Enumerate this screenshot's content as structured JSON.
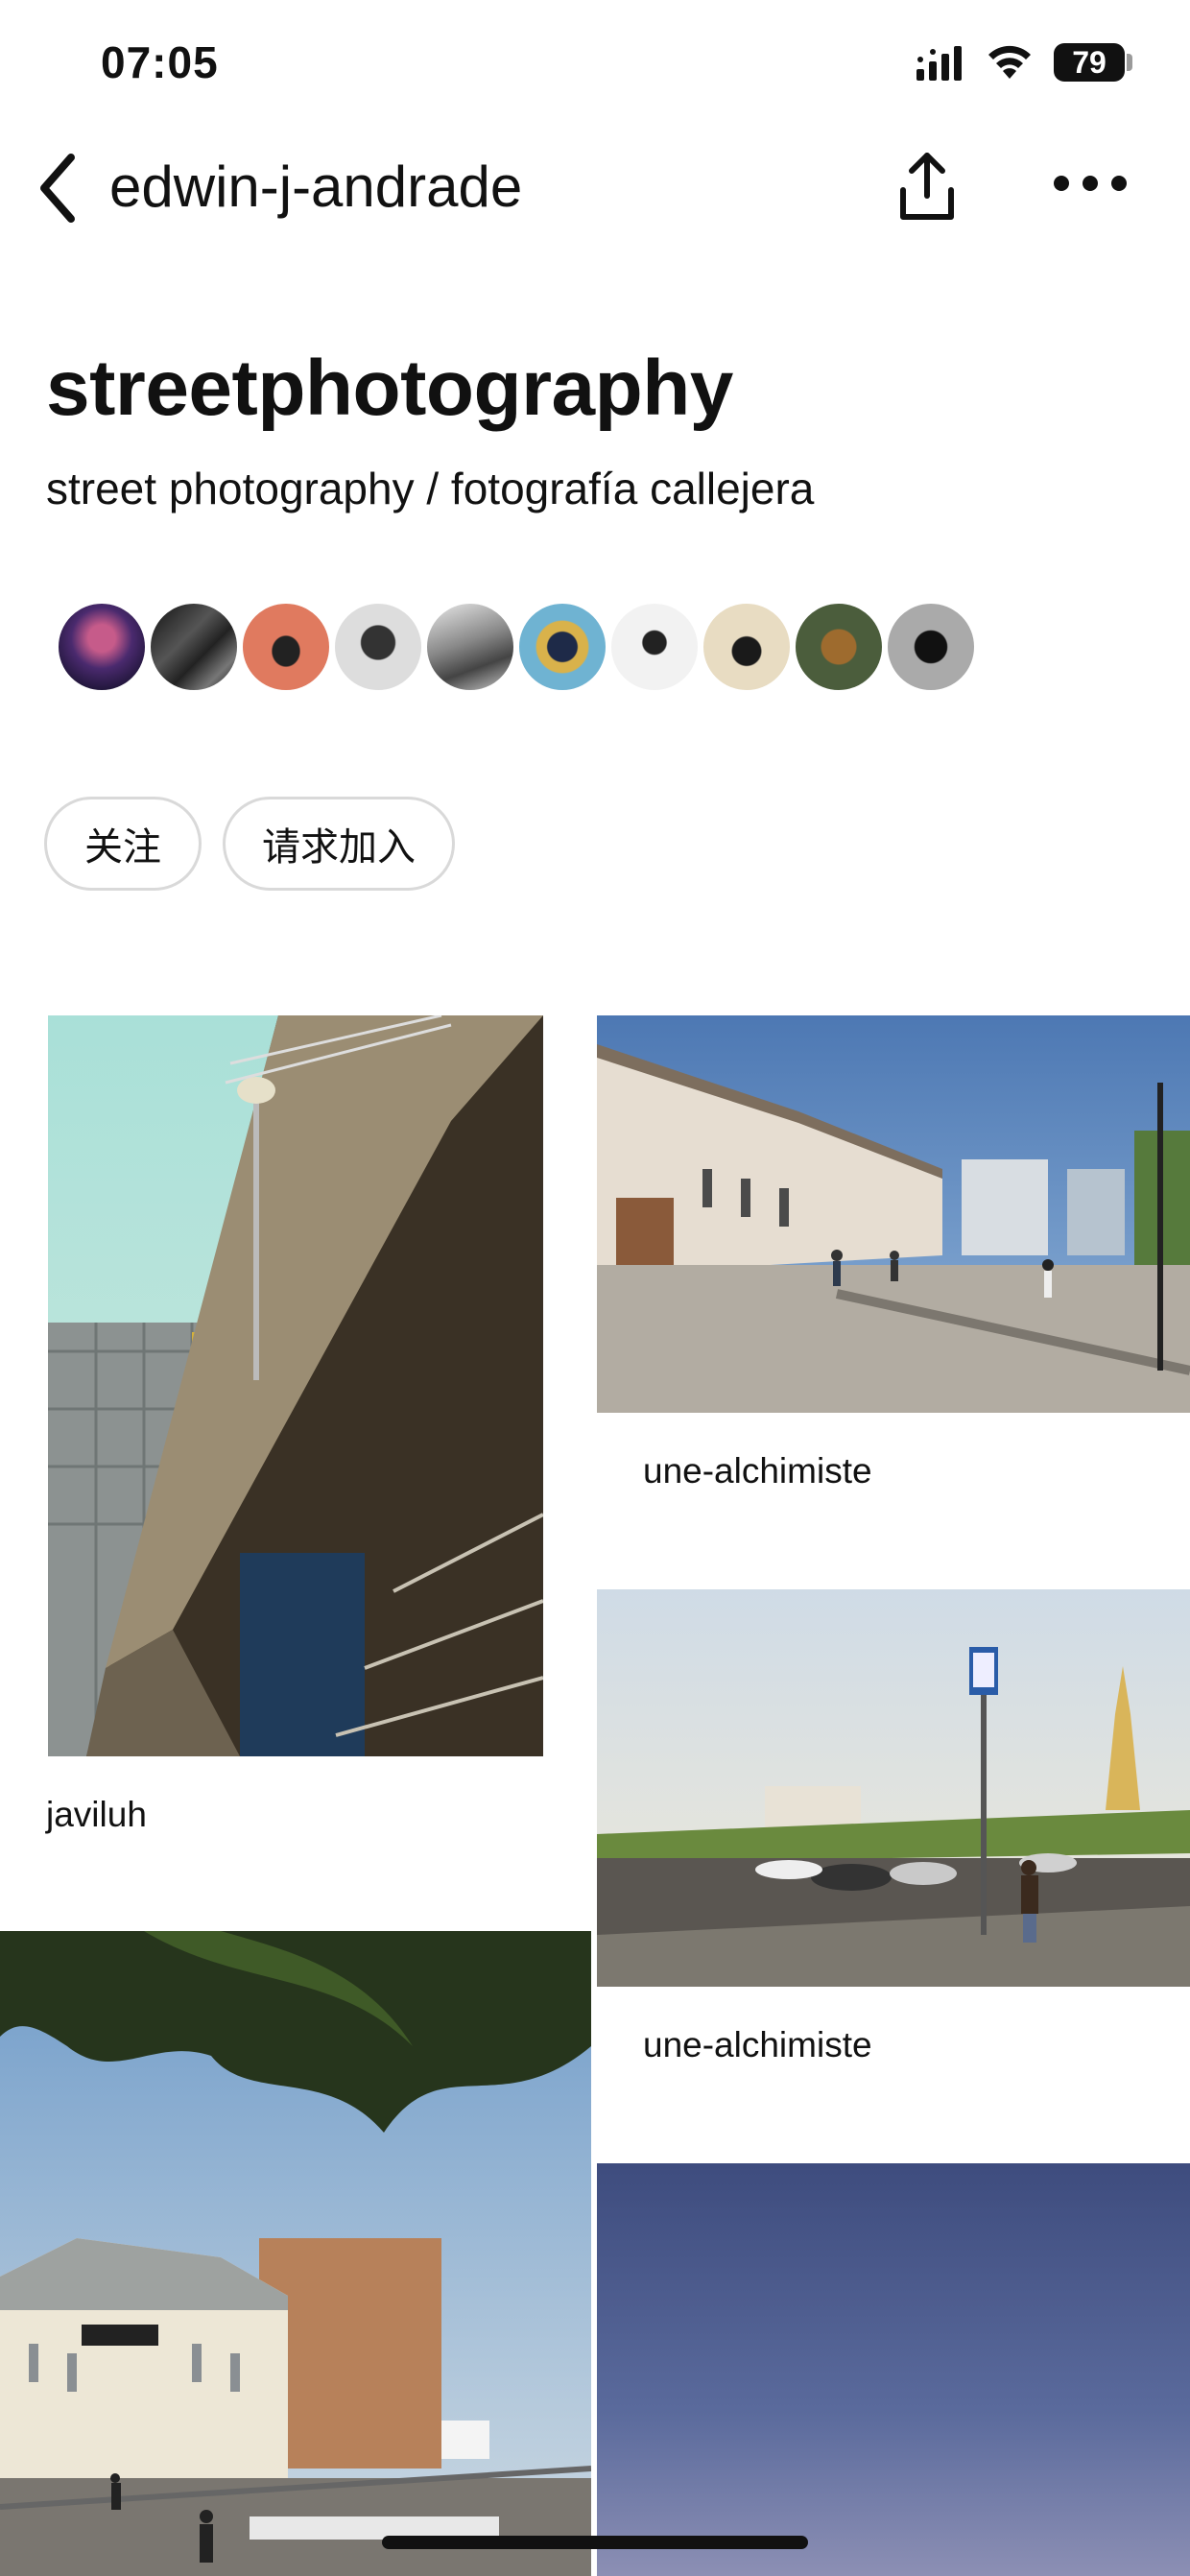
{
  "status_bar": {
    "time": "07:05",
    "battery": "79",
    "icons": [
      "signal-icon",
      "wifi-icon",
      "battery-icon"
    ]
  },
  "nav": {
    "title": "edwin-j-andrade",
    "icons": [
      "back-icon",
      "share-icon",
      "more-icon"
    ]
  },
  "board": {
    "title": "streetphotography",
    "description": "street photography / fotografía callejera"
  },
  "collaborators": {
    "count_shown": 10
  },
  "actions": {
    "follow_label": "关注",
    "request_join_label": "请求加入"
  },
  "pins": [
    {
      "caption": "javiluh",
      "subject": "overpass-with-street-lamp"
    },
    {
      "caption": "une-alchimiste",
      "subject": "street-with-old-buildings"
    },
    {
      "caption": "une-alchimiste",
      "subject": "road-with-bus-stop-and-bell-tower"
    },
    {
      "caption": "",
      "subject": "tree-over-old-street"
    },
    {
      "caption": "",
      "subject": "blue-sky"
    }
  ],
  "colors": {
    "text": "#111111",
    "button_border": "#d9d9d9",
    "background": "#ffffff"
  }
}
